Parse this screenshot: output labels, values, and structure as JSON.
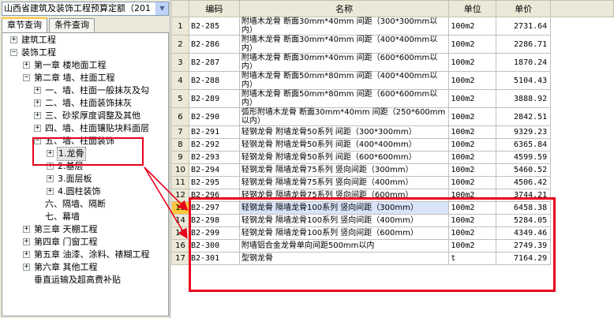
{
  "quota_select": {
    "value": "山西省建筑及装饰工程预算定额（201"
  },
  "tabs": [
    {
      "label": "章节查询",
      "active": true
    },
    {
      "label": "条件查询",
      "active": false
    }
  ],
  "tree": [
    {
      "label": "建筑工程",
      "level": 0,
      "expander": "+"
    },
    {
      "label": "装饰工程",
      "level": 0,
      "expander": "-"
    },
    {
      "label": "第一章  楼地面工程",
      "level": 1,
      "expander": "+"
    },
    {
      "label": "第二章  墙、柱面工程",
      "level": 1,
      "expander": "-"
    },
    {
      "label": "一、墙、柱面一般抹灰及勾",
      "level": 2,
      "expander": "+"
    },
    {
      "label": "二、墙、柱面装饰抹灰",
      "level": 2,
      "expander": "+"
    },
    {
      "label": "三、砂浆厚度调整及其他",
      "level": 2,
      "expander": "+"
    },
    {
      "label": "四、墙、柱面镶贴块料面层",
      "level": 2,
      "expander": "+"
    },
    {
      "label": "五、墙、柱面装饰",
      "level": 2,
      "expander": "-"
    },
    {
      "label": "1.龙骨",
      "level": 3,
      "expander": "+",
      "selected": true
    },
    {
      "label": "2.基层",
      "level": 3,
      "expander": "+"
    },
    {
      "label": "3.面层板",
      "level": 3,
      "expander": "+"
    },
    {
      "label": "4.圆柱装饰",
      "level": 3,
      "expander": "+"
    },
    {
      "label": "六、隔墙、隔断",
      "level": 2,
      "expander": ""
    },
    {
      "label": "七、幕墙",
      "level": 2,
      "expander": ""
    },
    {
      "label": "第三章  天棚工程",
      "level": 1,
      "expander": "+"
    },
    {
      "label": "第四章  门窗工程",
      "level": 1,
      "expander": "+"
    },
    {
      "label": "第五章  油漆、涂料、裱糊工程",
      "level": 1,
      "expander": "+"
    },
    {
      "label": "第六章  其他工程",
      "level": 1,
      "expander": "+"
    },
    {
      "label": "垂直运输及超高费补贴",
      "level": 1,
      "expander": ""
    }
  ],
  "table": {
    "headers": [
      "",
      "编码",
      "名称",
      "单位",
      "单价"
    ],
    "rows": [
      {
        "num": "1",
        "code": "B2-285",
        "name": "附墙木龙骨 断面30mm*40mm 间距（300*300mm以内）",
        "unit": "100m2",
        "price": "2731.64"
      },
      {
        "num": "2",
        "code": "B2-286",
        "name": "附墙木龙骨 断面30mm*40mm 间距（400*400mm以内）",
        "unit": "100m2",
        "price": "2286.71"
      },
      {
        "num": "3",
        "code": "B2-287",
        "name": "附墙木龙骨 断面30mm*40mm 间距（600*600mm以内）",
        "unit": "100m2",
        "price": "1870.24"
      },
      {
        "num": "4",
        "code": "B2-288",
        "name": "附墙木龙骨 断面50mm*80mm 间距（400*400mm以内）",
        "unit": "100m2",
        "price": "5104.43"
      },
      {
        "num": "5",
        "code": "B2-289",
        "name": "附墙木龙骨 断面50mm*80mm 间距（600*600mm以内）",
        "unit": "100m2",
        "price": "3888.92"
      },
      {
        "num": "6",
        "code": "B2-290",
        "name": "弧形附墙木龙骨 断面30mm*40mm 间距（250*600mm以内）",
        "unit": "100m2",
        "price": "2842.51"
      },
      {
        "num": "7",
        "code": "B2-291",
        "name": "轻钢龙骨 附墙龙骨50系列 间距（300*300mm）",
        "unit": "100m2",
        "price": "9329.23"
      },
      {
        "num": "8",
        "code": "B2-292",
        "name": "轻钢龙骨 附墙龙骨50系列 间距（400*400mm）",
        "unit": "100m2",
        "price": "6365.84"
      },
      {
        "num": "9",
        "code": "B2-293",
        "name": "轻钢龙骨 附墙龙骨50系列 间距（600*600mm）",
        "unit": "100m2",
        "price": "4599.59"
      },
      {
        "num": "10",
        "code": "B2-294",
        "name": "轻钢龙骨 隔墙龙骨75系列 竖向间距（300mm）",
        "unit": "100m2",
        "price": "5460.52"
      },
      {
        "num": "11",
        "code": "B2-295",
        "name": "轻钢龙骨 隔墙龙骨75系列 竖向间距（400mm）",
        "unit": "100m2",
        "price": "4506.42"
      },
      {
        "num": "12",
        "code": "B2-296",
        "name": "轻钢龙骨 隔墙龙骨75系列 竖向间距（600mm）",
        "unit": "100m2",
        "price": "3744.21"
      },
      {
        "num": "13",
        "code": "B2-297",
        "name": "轻钢龙骨 隔墙龙骨100系列 竖向间距（300mm）",
        "unit": "100m2",
        "price": "6458.38",
        "active": true
      },
      {
        "num": "14",
        "code": "B2-298",
        "name": "轻钢龙骨 隔墙龙骨100系列 竖向间距（400mm）",
        "unit": "100m2",
        "price": "5284.05"
      },
      {
        "num": "15",
        "code": "B2-299",
        "name": "轻钢龙骨 隔墙龙骨100系列 竖向间距（600mm）",
        "unit": "100m2",
        "price": "4349.46"
      },
      {
        "num": "16",
        "code": "B2-300",
        "name": "附墙铝合金龙骨单向间距500mm以内",
        "unit": "100m2",
        "price": "2749.39"
      },
      {
        "num": "17",
        "code": "B2-301",
        "name": "型钢龙骨",
        "unit": "t",
        "price": "7164.29"
      }
    ]
  },
  "annotation_color": "#e8001c"
}
